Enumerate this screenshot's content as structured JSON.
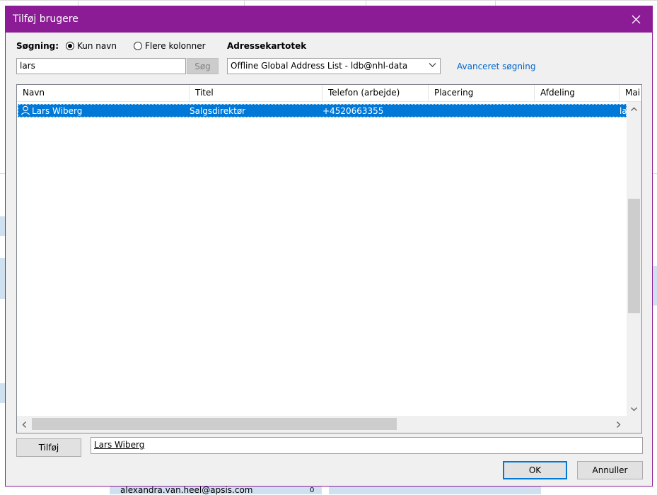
{
  "background": {
    "bottom_email": "alexandra.van.heel@apsis.com",
    "bottom_suffix": "0"
  },
  "dialog": {
    "title": "Tilføj brugere",
    "search_label": "Søgning:",
    "radio_name_only": "Kun navn",
    "radio_more_columns": "Flere kolonner",
    "address_book_label": "Adressekartotek",
    "search_value": "lars",
    "search_button": "Søg",
    "address_book_value": "Offline Global Address List - ldb@nhl-data",
    "advanced_search": "Avanceret søgning",
    "columns": [
      "Navn",
      "Titel",
      "Telefon (arbejde)",
      "Placering",
      "Afdeling",
      "Mai"
    ],
    "rows": [
      {
        "name": "Lars Wiberg",
        "title": "Salgsdirektør",
        "phone": "+4520663355",
        "location": "",
        "department": "",
        "mail": "la"
      }
    ],
    "add_button": "Tilføj",
    "added_users": "Lars Wiberg",
    "ok_button": "OK",
    "cancel_button": "Annuller"
  },
  "colors": {
    "accent": "#8b1c95",
    "selection": "#0078d7"
  }
}
